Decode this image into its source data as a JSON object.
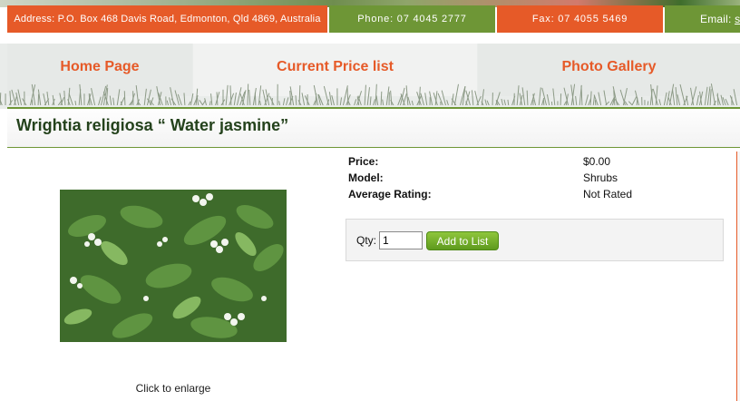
{
  "contact": {
    "address": "Address: P.O. Box 468 Davis Road, Edmonton, Qld 4869, Australia",
    "phone": "Phone: 07 4045 2777",
    "fax": "Fax: 07 4055 5469",
    "email_label": "Email:",
    "email_link": "sa"
  },
  "nav": {
    "items": [
      {
        "label": "Home Page"
      },
      {
        "label": "Current Price list"
      },
      {
        "label": "Photo Gallery"
      }
    ]
  },
  "product": {
    "title": "Wrightia religiosa “ Water jasmine”",
    "image_caption": "Click to enlarge",
    "price_label": "Price:",
    "price_value": "$0.00",
    "model_label": "Model:",
    "model_value": "Shrubs",
    "rating_label": "Average Rating:",
    "rating_value": "Not Rated"
  },
  "cart": {
    "qty_label": "Qty:",
    "qty_value": "1",
    "add_button_label": "Add to List"
  },
  "colors": {
    "accent_orange": "#e65a28",
    "accent_green": "#6e9636",
    "title_green": "#24421c",
    "button_green": "#6aab28"
  }
}
